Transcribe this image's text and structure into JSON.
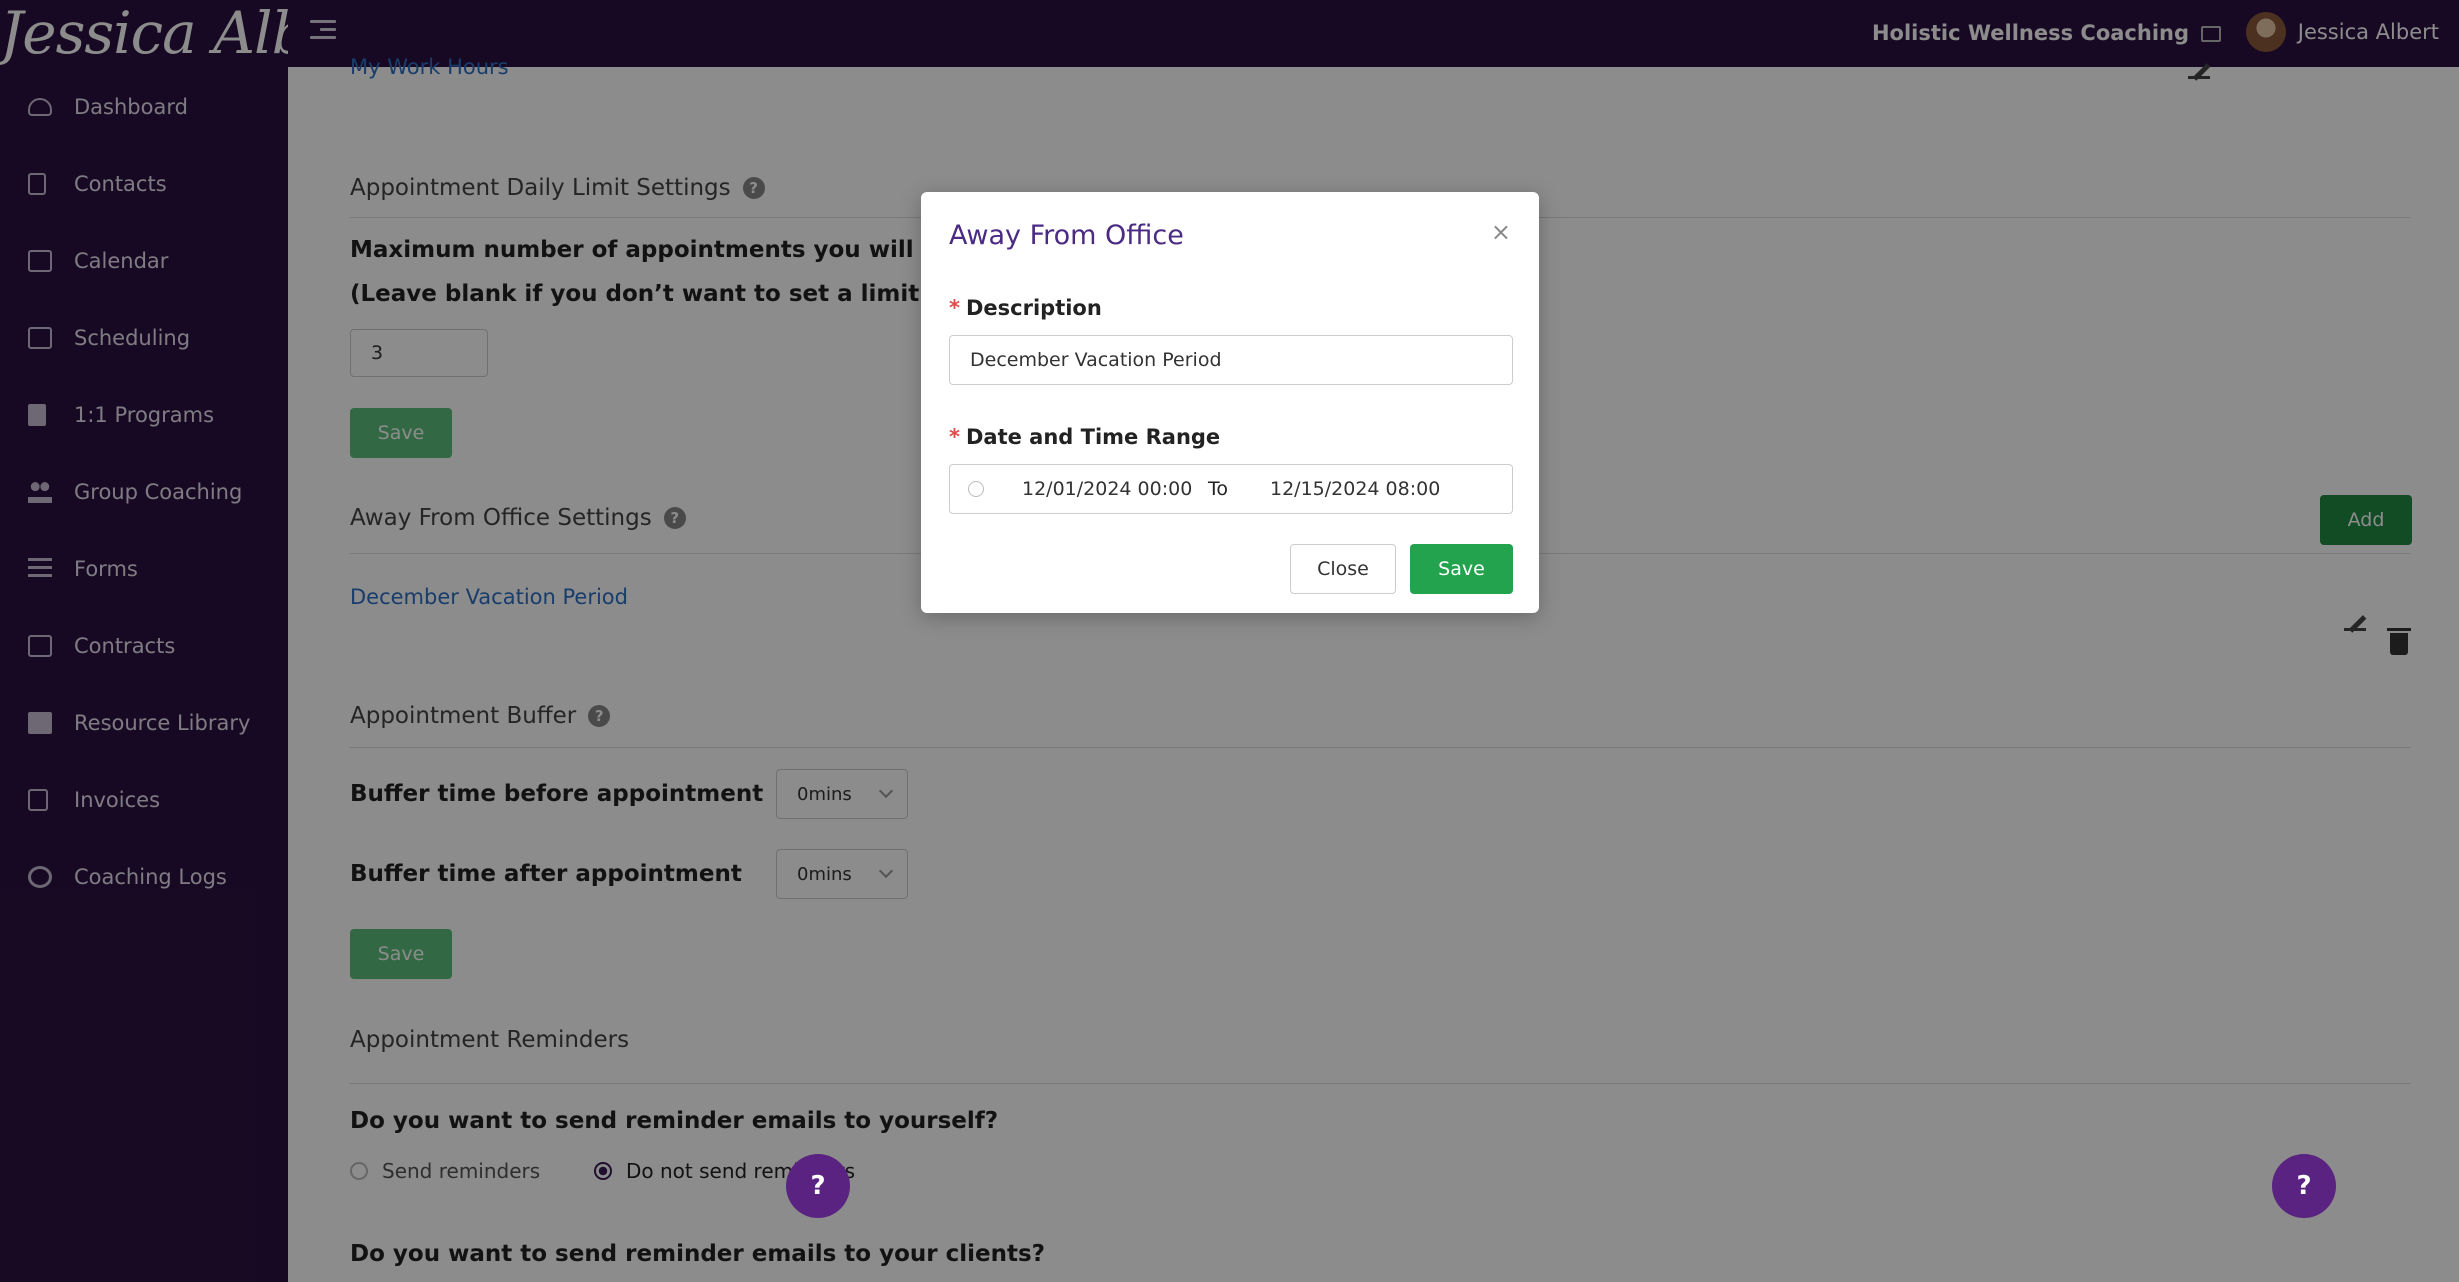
{
  "header": {
    "logo_text": "Jessica Albert",
    "business_name": "Holistic Wellness Coaching",
    "user_name": "Jessica Albert"
  },
  "sidebar": {
    "items": [
      {
        "label": "Dashboard",
        "icon": "dashboard-icon"
      },
      {
        "label": "Contacts",
        "icon": "contacts-icon"
      },
      {
        "label": "Calendar",
        "icon": "calendar-icon"
      },
      {
        "label": "Scheduling",
        "icon": "scheduling-icon"
      },
      {
        "label": "1:1 Programs",
        "icon": "book-icon"
      },
      {
        "label": "Group Coaching",
        "icon": "people-icon"
      },
      {
        "label": "Forms",
        "icon": "list-icon"
      },
      {
        "label": "Contracts",
        "icon": "contract-icon"
      },
      {
        "label": "Resource Library",
        "icon": "library-icon"
      },
      {
        "label": "Invoices",
        "icon": "invoice-icon"
      },
      {
        "label": "Coaching Logs",
        "icon": "clock-icon"
      }
    ]
  },
  "main": {
    "work_hours_link": "My Work Hours",
    "daily_limit": {
      "title": "Appointment Daily Limit Settings",
      "question": "Maximum number of appointments you will acc",
      "hint": "(Leave blank if you don’t want to set a limit)",
      "value": "3",
      "save_label": "Save"
    },
    "away": {
      "title": "Away From Office Settings",
      "add_label": "Add",
      "entry": "December Vacation Period"
    },
    "buffer": {
      "title": "Appointment Buffer",
      "before_label": "Buffer time before appointment",
      "before_value": "0mins",
      "after_label": "Buffer time after appointment",
      "after_value": "0mins",
      "save_label": "Save"
    },
    "reminders": {
      "title": "Appointment Reminders",
      "self_question": "Do you want to send reminder emails to yourself?",
      "option_send": "Send reminders",
      "option_no": "Do not send reminders",
      "client_question": "Do you want to send reminder emails to your clients?"
    },
    "help_label": "?"
  },
  "modal": {
    "title": "Away From Office",
    "close_glyph": "×",
    "description_label": "Description",
    "description_value": "December Vacation Period",
    "range_label": "Date and Time Range",
    "start": "12/01/2024 00:00",
    "to": "To",
    "end": "12/15/2024 08:00",
    "close_label": "Close",
    "save_label": "Save"
  },
  "colors": {
    "sidebar_bg": "#2b1240",
    "accent_green": "#24a34e",
    "modal_title": "#4a2a83",
    "link": "#2f6fc4"
  }
}
